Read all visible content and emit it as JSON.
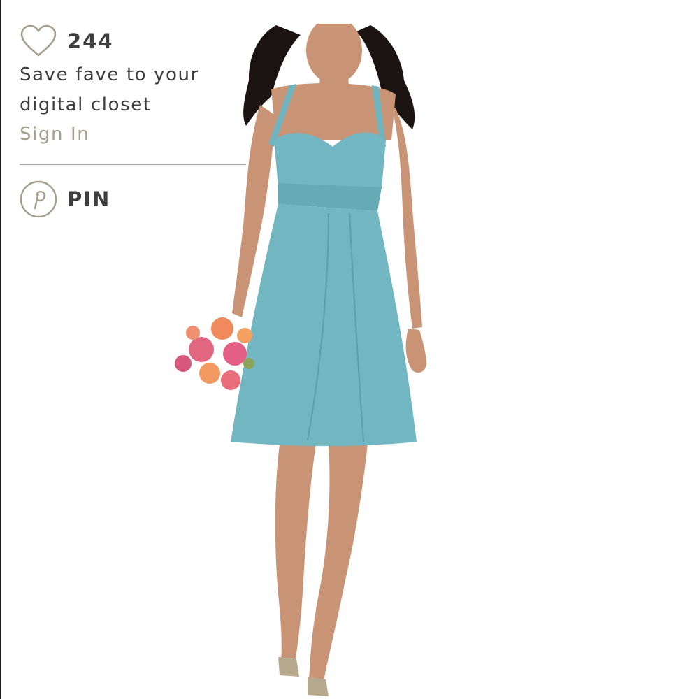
{
  "fave": {
    "count": "244",
    "line1": "Save fave to your",
    "line2": "digital closet",
    "sign_in": "Sign In"
  },
  "pin": {
    "label": "PIN"
  },
  "icons": {
    "fave": "heart-outline-icon",
    "pin": "pinterest-icon"
  },
  "colors": {
    "text": "#3d3d3d",
    "sign_in": "#a39f8c",
    "icon_stroke": "#a39f8c",
    "divider": "#a7a6ad",
    "dress": "#72b6c1"
  }
}
